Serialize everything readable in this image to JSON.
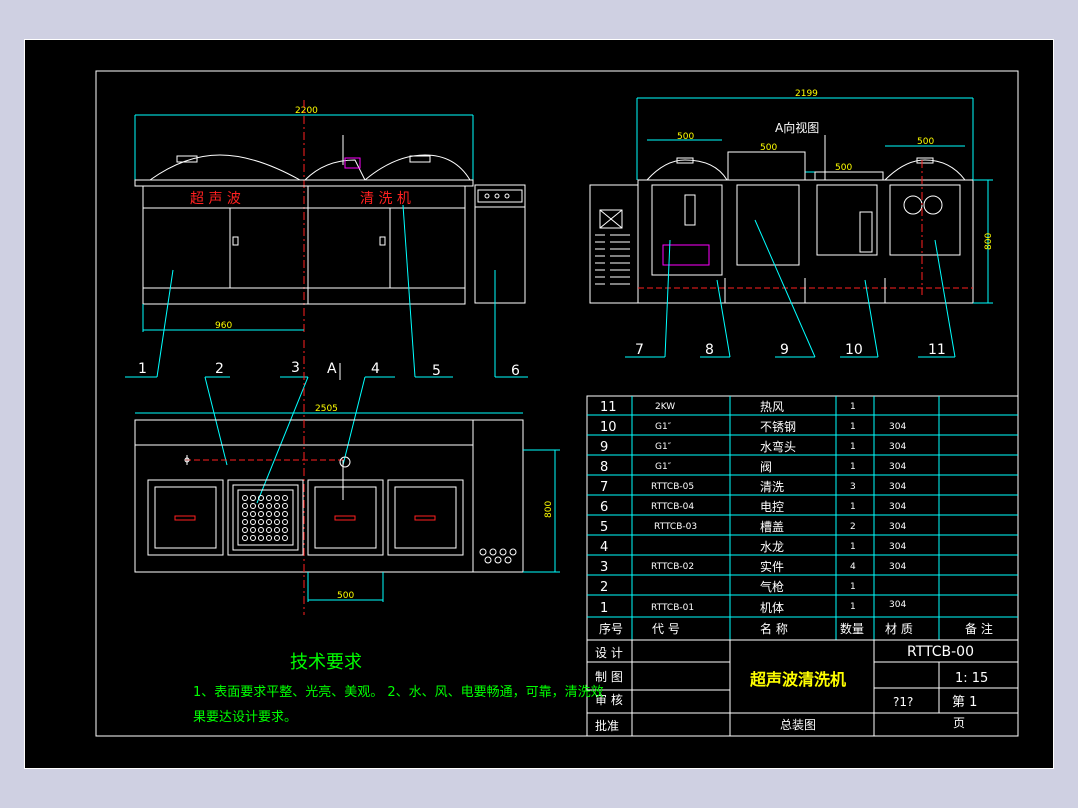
{
  "drawing": {
    "title_block": {
      "design_label": "设 计",
      "drawn_label": "制 图",
      "review_label": "审 核",
      "approve_label": "批准",
      "product_name": "超声波清洗机",
      "drawing_no": "RTTCB-00",
      "scale": "1: 15",
      "sheet_label": "第 1",
      "pages_label": "页",
      "unknown_label": "?1?",
      "assembly_label": "总装图"
    },
    "bom_header": {
      "seq": "序号",
      "code": "代 号",
      "name": "名 称",
      "qty": "数量",
      "material": "材 质",
      "remark": "备 注"
    },
    "bom_rows": [
      {
        "seq": "11",
        "code": "2KW",
        "name": "热风",
        "qty": "1",
        "material": ""
      },
      {
        "seq": "10",
        "code": "G1″",
        "name": "不锈钢",
        "qty": "1",
        "material": "304"
      },
      {
        "seq": "9",
        "code": "G1″",
        "name": "水弯头",
        "qty": "1",
        "material": "304"
      },
      {
        "seq": "8",
        "code": "G1″",
        "name": "阀",
        "qty": "1",
        "material": "304"
      },
      {
        "seq": "7",
        "code": "RTTCB-05",
        "name": "清洗",
        "qty": "3",
        "material": "304"
      },
      {
        "seq": "6",
        "code": "RTTCB-04",
        "name": "电控",
        "qty": "1",
        "material": "304"
      },
      {
        "seq": "5",
        "code": "RTTCB-03",
        "name": "槽盖",
        "qty": "2",
        "material": "304"
      },
      {
        "seq": "4",
        "code": "",
        "name": "水龙",
        "qty": "1",
        "material": "304"
      },
      {
        "seq": "3",
        "code": "RTTCB-02",
        "name": "实件",
        "qty": "4",
        "material": "304"
      },
      {
        "seq": "2",
        "code": "",
        "name": "气枪",
        "qty": "1",
        "material": ""
      },
      {
        "seq": "1",
        "code": "RTTCB-01",
        "name": "机体",
        "qty": "1",
        "material": "304"
      }
    ],
    "front_view": {
      "dim_total": "2200",
      "dim_half": "960",
      "label_left": "超 声 波",
      "label_right": "清 洗 机"
    },
    "side_view": {
      "title": "A向视图",
      "dim_total": "2199",
      "dim_500a": "500",
      "dim_500b": "500",
      "dim_500c": "500",
      "dim_500d": "500",
      "dim_height": "800"
    },
    "top_view": {
      "dim_total": "2505",
      "dim_depth": "800",
      "dim_500": "500"
    },
    "callouts_left": [
      "1",
      "2",
      "3",
      "4",
      "5",
      "6"
    ],
    "callout_a": "A",
    "callouts_right": [
      "7",
      "8",
      "9",
      "10",
      "11"
    ],
    "tech": {
      "title": "技术要求",
      "line1": "1、表面要求平整、光亮、美观。  2、水、风、电要畅通，可靠，清洗效",
      "line2": "果要达设计要求。"
    },
    "colors": {
      "cyan": "#00ffff",
      "red": "#ff2020",
      "white": "#ffffff",
      "green": "#00ff00",
      "yellow": "#ffff00",
      "magenta": "#ff00ff"
    }
  }
}
